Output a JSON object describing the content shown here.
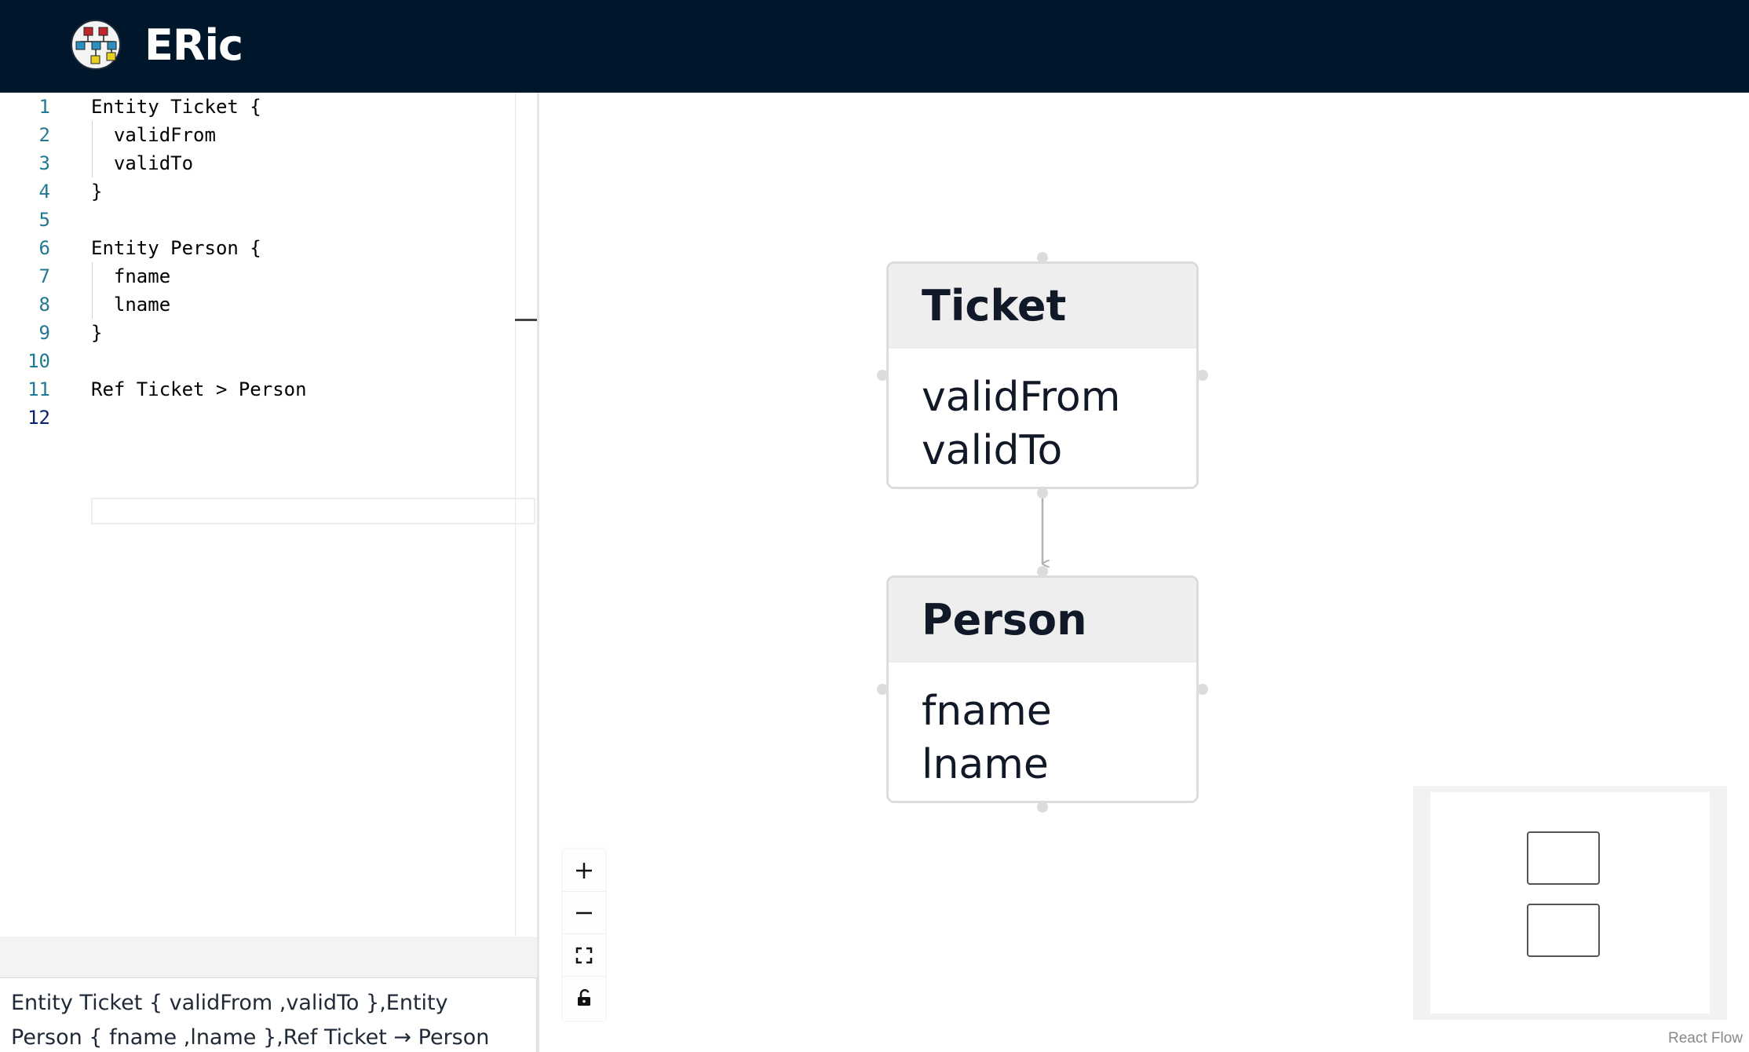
{
  "app": {
    "title": "ERic",
    "logo_icon": "er-diagram-logo-icon"
  },
  "editor": {
    "lines": [
      {
        "number": "1",
        "text": "Entity Ticket {"
      },
      {
        "number": "2",
        "text": "  validFrom"
      },
      {
        "number": "3",
        "text": "  validTo"
      },
      {
        "number": "4",
        "text": "}"
      },
      {
        "number": "5",
        "text": ""
      },
      {
        "number": "6",
        "text": "Entity Person {"
      },
      {
        "number": "7",
        "text": "  fname"
      },
      {
        "number": "8",
        "text": "  lname"
      },
      {
        "number": "9",
        "text": "}"
      },
      {
        "number": "10",
        "text": ""
      },
      {
        "number": "11",
        "text": "Ref Ticket > Person"
      },
      {
        "number": "12",
        "text": ""
      }
    ],
    "active_line": "12"
  },
  "output": {
    "text": "Entity Ticket { validFrom ,validTo  },Entity Person { fname ,lname  },Ref Ticket → Person"
  },
  "diagram": {
    "nodes": [
      {
        "title": "Ticket",
        "fields": [
          "validFrom",
          "validTo"
        ]
      },
      {
        "title": "Person",
        "fields": [
          "fname",
          "lname"
        ]
      }
    ],
    "edges": [
      {
        "from": "Ticket",
        "to": "Person"
      }
    ]
  },
  "controls": {
    "zoom_in_icon": "plus-icon",
    "zoom_out_icon": "minus-icon",
    "fit_view_icon": "fit-view-icon",
    "lock_icon": "unlock-icon"
  },
  "attribution": "React Flow",
  "colors": {
    "header_bg": "#00162b",
    "line_number": "#237893",
    "node_header_bg": "#eeeeee",
    "node_border": "#dcdcdc"
  }
}
